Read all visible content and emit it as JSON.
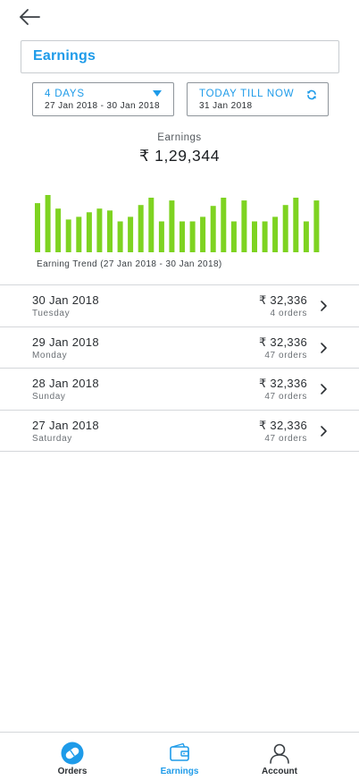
{
  "header": {
    "title": "Earnings"
  },
  "filters": {
    "period": {
      "label": "4 DAYS",
      "range": "27 Jan 2018 - 30 Jan 2018"
    },
    "today": {
      "label": "TODAY TILL NOW",
      "date": "31 Jan 2018"
    }
  },
  "summary": {
    "label": "Earnings",
    "total": "₹ 1,29,344"
  },
  "chart_data": {
    "type": "bar",
    "caption": "Earning Trend (27 Jan 2018 - 30 Jan 2018)",
    "color": "#7ed321",
    "values": [
      54,
      63,
      48,
      36,
      39,
      44,
      48,
      46,
      34,
      39,
      52,
      60,
      34,
      57,
      34,
      34,
      39,
      51,
      60,
      34,
      57,
      34,
      34,
      39,
      52,
      60,
      34,
      57
    ]
  },
  "rows": [
    {
      "date": "30 Jan 2018",
      "day": "Tuesday",
      "amount": "₹ 32,336",
      "orders": "4 orders"
    },
    {
      "date": "29 Jan 2018",
      "day": "Monday",
      "amount": "₹ 32,336",
      "orders": "47 orders"
    },
    {
      "date": "28 Jan 2018",
      "day": "Sunday",
      "amount": "₹ 32,336",
      "orders": "47 orders"
    },
    {
      "date": "27 Jan 2018",
      "day": "Saturday",
      "amount": "₹ 32,336",
      "orders": "47 orders"
    }
  ],
  "tabs": [
    {
      "label": "Orders",
      "icon": "orders-icon",
      "active": false
    },
    {
      "label": "Earnings",
      "icon": "wallet-icon",
      "active": true
    },
    {
      "label": "Account",
      "icon": "account-icon",
      "active": false
    }
  ],
  "colors": {
    "accent": "#1e9be9",
    "bar": "#7ed321"
  }
}
